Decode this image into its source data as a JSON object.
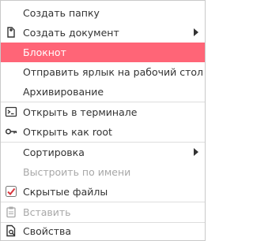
{
  "menu": {
    "items": [
      {
        "label": "Создать папку"
      },
      {
        "label": "Создать документ"
      },
      {
        "label": "Блокнот"
      },
      {
        "label": "Отправить ярлык на рабочий стол"
      },
      {
        "label": "Архивирование"
      },
      {
        "label": "Открыть в терминале"
      },
      {
        "label": "Открыть как root"
      },
      {
        "label": "Сортировка"
      },
      {
        "label": "Выстроить по имени"
      },
      {
        "label": "Скрытые файлы"
      },
      {
        "label": "Вставить"
      },
      {
        "label": "Свойства"
      }
    ]
  },
  "colors": {
    "highlight": "#ff6577",
    "checkmark": "#d9363e",
    "disabled_text": "#a8a8a8"
  },
  "icons": [
    "new-document-icon",
    "terminal-icon",
    "key-icon",
    "checkmark-icon",
    "paste-icon",
    "properties-icon",
    "submenu-arrow-icon"
  ]
}
